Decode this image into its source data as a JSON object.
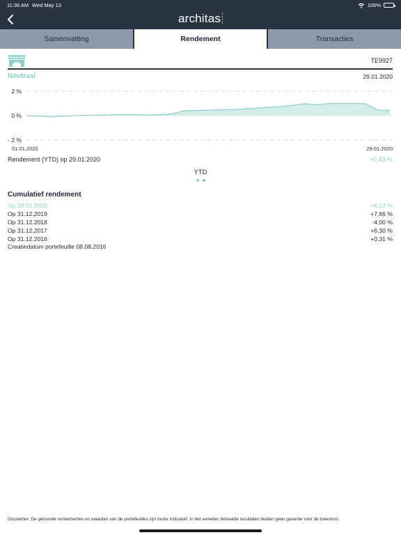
{
  "status_bar": {
    "time": "11:36 AM",
    "date": "Wed May 13",
    "battery": "100%",
    "wifi_icon": "wifi-icon",
    "battery_icon": "battery-icon"
  },
  "nav": {
    "logo": "architas",
    "back_icon": "chevron-left-icon"
  },
  "tabs": [
    {
      "label": "Samenvatting",
      "active": false
    },
    {
      "label": "Rendement",
      "active": true
    },
    {
      "label": "Transacties",
      "active": false
    }
  ],
  "portfolio": {
    "icon": "bridge-icon",
    "id": "TE9927"
  },
  "profile": {
    "name": "Neutraal",
    "date": "29.01.2020"
  },
  "chart_data": {
    "type": "area",
    "x_start_label": "01.01.2020",
    "x_end_label": "29.01.2020",
    "y_ticks": [
      "2 %",
      "0 %",
      "- 2 %"
    ],
    "ylim": [
      -2,
      2
    ],
    "grid": true,
    "color": "#8fd0c8",
    "series": [
      {
        "values": [
          0.0,
          -0.05,
          -0.1,
          -0.05,
          0.0,
          0.03,
          0.05,
          0.07,
          0.09,
          0.08,
          0.05,
          0.08,
          0.15,
          0.4,
          0.42,
          0.45,
          0.48,
          0.5,
          0.55,
          0.62,
          0.68,
          0.75,
          0.85,
          0.98,
          0.9,
          1.0,
          1.0,
          1.0,
          0.98,
          0.45,
          0.43
        ]
      }
    ]
  },
  "ytd": {
    "label": "Rendement (YTD) op 29.01.2020",
    "value": "+0,43 %",
    "page_title": "YTD"
  },
  "cumulative": {
    "title": "Cumulatief rendement",
    "rows": [
      {
        "label": "Op 29.01.2020",
        "value": "+8,12 %",
        "highlight": true
      },
      {
        "label": "Op 31.12.2019",
        "value": "+7,66 %",
        "highlight": false
      },
      {
        "label": "Op 31.12.2018",
        "value": "-4,00 %",
        "highlight": false
      },
      {
        "label": "Op 31.12.2017",
        "value": "+6,30 %",
        "highlight": false
      },
      {
        "label": "Op 31.12.2016",
        "value": "+0,31 %",
        "highlight": false
      }
    ],
    "created": "Creatiedatum portefeuille 08.08.2016"
  },
  "disclaimer": "Disclaimer: De getoonde rendementen en waarden van de portefeuilles zijn louter indicatief. In het verleden behaalde resultaten bieden geen garantie voor de toekomst."
}
